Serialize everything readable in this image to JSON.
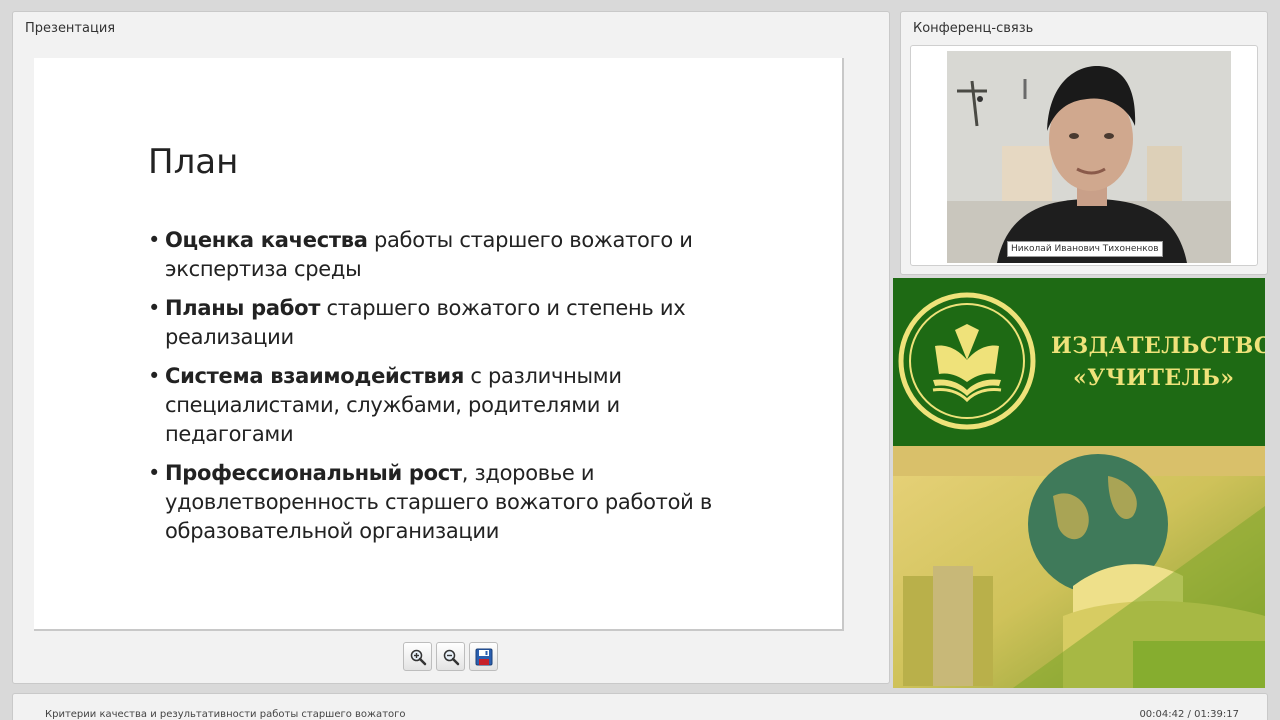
{
  "presentation": {
    "panel_title": "Презентация",
    "slide": {
      "title": "План",
      "bullets": [
        {
          "bold": "Оценка качества",
          "text": " работы старшего вожатого и экспертиза среды"
        },
        {
          "bold": "Планы работ",
          "text": " старшего вожатого и степень их реализации"
        },
        {
          "bold": "Система взаимодействия",
          "text": " с различными специалистами, службами, родителями и педагогами"
        },
        {
          "bold": "Профессиональный рост",
          "text": ", здоровье и удовлетворенность старшего вожатого работой в образовательной организации"
        }
      ]
    },
    "toolbar": {
      "zoom_in_icon": "zoom-in-icon",
      "zoom_out_icon": "zoom-out-icon",
      "save_icon": "floppy-disk-icon"
    }
  },
  "conference": {
    "panel_title": "Конференц-связь",
    "speaker_name": "Николай Иванович Тихоненков"
  },
  "publisher": {
    "name_line1": "ИЗДАТЕЛЬСТВО",
    "name_line2": "«УЧИТЕЛЬ»",
    "brand_green": "#1e6a14",
    "brand_yellow": "#efe27a"
  },
  "footer": {
    "lecture_title": "Критерии качества и результативности работы старшего вожатого",
    "timer": "00:04:42 / 01:39:17"
  }
}
